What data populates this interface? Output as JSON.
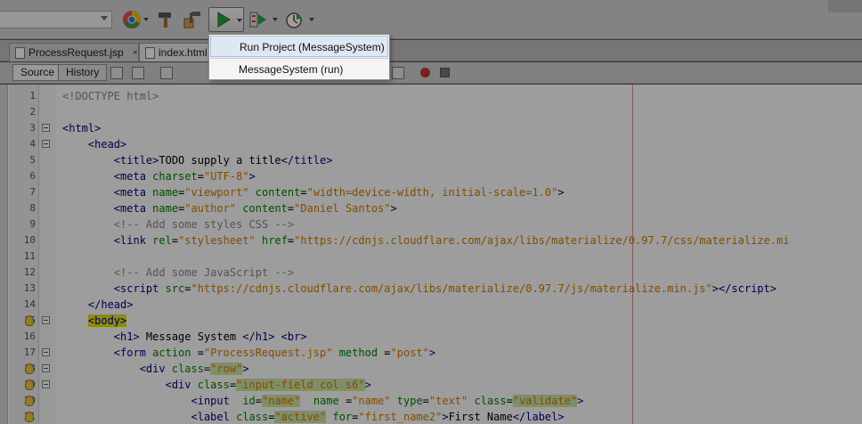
{
  "run_menu": {
    "items": [
      "Run Project (MessageSystem)",
      "MessageSystem (run)"
    ]
  },
  "tabs": [
    {
      "label": "ProcessRequest.jsp",
      "close": "×"
    },
    {
      "label": "index.html"
    }
  ],
  "editor_toolbar": {
    "source_label": "Source",
    "history_label": "History"
  },
  "lines": [
    {
      "n": "1",
      "html": "<span class='c'>&lt;!DOCTYPE html&gt;</span>"
    },
    {
      "n": "2",
      "html": ""
    },
    {
      "n": "3",
      "html": "<span class='t'>&lt;html&gt;</span>",
      "fold": true
    },
    {
      "n": "4",
      "html": "    <span class='t'>&lt;head&gt;</span>",
      "fold": true
    },
    {
      "n": "5",
      "html": "        <span class='t'>&lt;title&gt;</span>TODO supply a title<span class='t'>&lt;/title&gt;</span>"
    },
    {
      "n": "6",
      "html": "        <span class='t'>&lt;meta</span> <span class='a'>charset</span>=<span class='s'>\"UTF-8\"</span><span class='t'>&gt;</span>"
    },
    {
      "n": "7",
      "html": "        <span class='t'>&lt;meta</span> <span class='a'>name</span>=<span class='s'>\"viewport\"</span> <span class='a'>content</span>=<span class='s'>\"width=device-width, initial-scale=1.0\"</span><span class='t'>&gt;</span>"
    },
    {
      "n": "8",
      "html": "        <span class='t'>&lt;meta</span> <span class='a'>name</span>=<span class='s'>\"author\"</span> <span class='a'>content</span>=<span class='s'>\"Daniel Santos\"</span><span class='t'>&gt;</span>"
    },
    {
      "n": "9",
      "html": "        <span class='c'>&lt;!-- Add some styles CSS --&gt;</span>"
    },
    {
      "n": "10",
      "html": "        <span class='t'>&lt;link</span> <span class='a'>rel</span>=<span class='s'>\"stylesheet\"</span> <span class='a'>href</span>=<span class='s'>\"https://cdnjs.cloudflare.com/ajax/libs/materialize/0.97.7/css/materialize.mi</span>"
    },
    {
      "n": "11",
      "html": ""
    },
    {
      "n": "12",
      "html": "        <span class='c'>&lt;!-- Add some JavaScript --&gt;</span>"
    },
    {
      "n": "13",
      "html": "        <span class='t'>&lt;script</span> <span class='a'>src</span>=<span class='s'>\"https://cdnjs.cloudflare.com/ajax/libs/materialize/0.97.7/js/materialize.min.js\"</span><span class='t'>&gt;&lt;/script&gt;</span>"
    },
    {
      "n": "14",
      "html": "    <span class='t'>&lt;/head&gt;</span>"
    },
    {
      "n": "15",
      "html": "    <span class='t y'>&lt;body&gt;</span>",
      "bulb": true,
      "fold": true
    },
    {
      "n": "16",
      "html": "        <span class='t'>&lt;h1&gt;</span> Message System <span class='t'>&lt;/h1&gt;</span> <span class='t'>&lt;br&gt;</span>"
    },
    {
      "n": "17",
      "html": "        <span class='t'>&lt;form</span> <span class='a'>action</span> =<span class='s'>\"ProcessRequest.jsp\"</span> <span class='a'>method</span> =<span class='s'>\"post\"</span><span class='t'>&gt;</span>",
      "fold": true
    },
    {
      "n": "18",
      "html": "            <span class='t'>&lt;div</span> <span class='a'>class</span>=<span class='s hl'>\"row\"</span><span class='t'>&gt;</span>",
      "bulb": true,
      "fold": true
    },
    {
      "n": "19",
      "html": "                <span class='t'>&lt;div</span> <span class='a'>class</span>=<span class='s hl'>\"input-field col s6\"</span><span class='t'>&gt;</span>",
      "bulb": true,
      "fold": true
    },
    {
      "n": "20",
      "html": "                    <span class='t'>&lt;input</span>  <span class='a'>id</span>=<span class='s hl'>\"name\"</span>  <span class='a'>name</span> =<span class='s'>\"name\"</span> <span class='a'>type</span>=<span class='s'>\"text\"</span> <span class='a'>class</span>=<span class='s hl'>\"validate\"</span><span class='t'>&gt;</span>",
      "bulb": true
    },
    {
      "n": "21",
      "html": "                    <span class='t'>&lt;label</span> <span class='a'>class</span>=<span class='s hl'>\"active\"</span> <span class='a'>for</span>=<span class='s'>\"first_name2\"</span><span class='t'>&gt;</span>First Name<span class='t'>&lt;/label&gt;</span>",
      "bulb": true
    }
  ]
}
